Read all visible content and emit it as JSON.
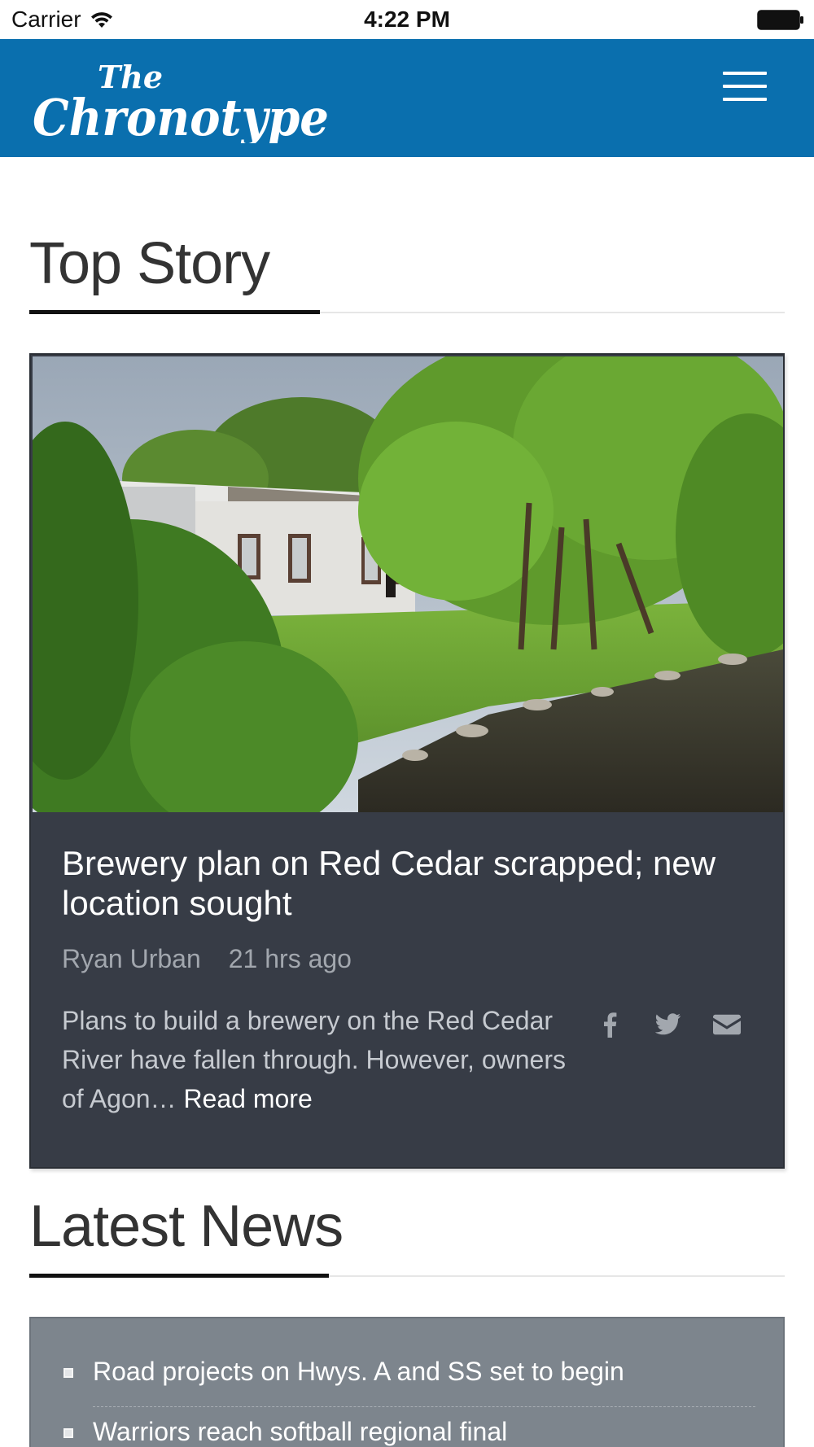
{
  "status_bar": {
    "carrier": "Carrier",
    "time": "4:22 PM"
  },
  "header": {
    "logo_line1": "The",
    "logo_line2": "Chronotype",
    "brand_color": "#0a6fae",
    "menu_icon": "hamburger-menu-icon"
  },
  "top_story": {
    "section_title": "Top Story",
    "headline": "Brewery plan on Red Cedar scrapped; new location sought",
    "author": "Ryan Urban",
    "time_ago": "21 hrs ago",
    "summary": "Plans to build a brewery on the Red Cedar River have fallen through. However, owners of Agon…",
    "read_more": "Read more",
    "share_icons": [
      "facebook-icon",
      "twitter-icon",
      "email-icon"
    ],
    "card_color": "#373c46"
  },
  "latest_news": {
    "section_title": "Latest News",
    "items": [
      "Road projects on Hwys. A and SS set to begin",
      "Warriors reach softball regional final"
    ],
    "panel_color": "#7d858d"
  }
}
